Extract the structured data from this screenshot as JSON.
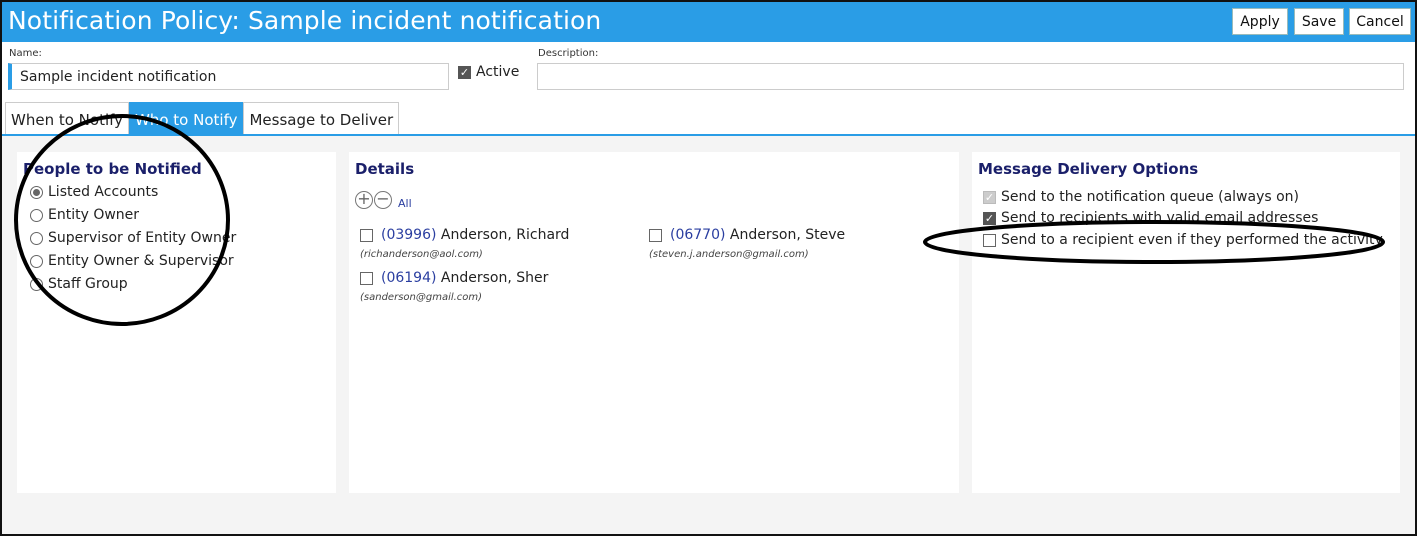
{
  "header": {
    "title": "Notification Policy: Sample incident notification",
    "apply_label": "Apply",
    "save_label": "Save",
    "cancel_label": "Cancel"
  },
  "form": {
    "name_label": "Name:",
    "name_value": "Sample incident notification",
    "active_label": "Active",
    "active_checked": true,
    "description_label": "Description:",
    "description_value": ""
  },
  "tabs": [
    {
      "label": "When to Notify"
    },
    {
      "label": "Who to Notify",
      "active": true
    },
    {
      "label": "Message to Deliver"
    }
  ],
  "people_panel": {
    "title": "People to be Notified",
    "options": [
      {
        "label": "Listed Accounts",
        "selected": true
      },
      {
        "label": "Entity Owner"
      },
      {
        "label": "Supervisor of Entity Owner"
      },
      {
        "label": "Entity Owner & Supervisor"
      },
      {
        "label": "Staff Group"
      }
    ]
  },
  "details_panel": {
    "title": "Details",
    "plus_glyph": "+",
    "minus_glyph": "−",
    "all_label": "All",
    "people": [
      {
        "id": "(03996)",
        "name": "Anderson, Richard",
        "email": "(richanderson@aol.com)"
      },
      {
        "id": "(06194)",
        "name": "Anderson, Sher",
        "email": "(sanderson@gmail.com)"
      },
      {
        "id": "(06770)",
        "name": "Anderson, Steve",
        "email": "(steven.j.anderson@gmail.com)"
      }
    ]
  },
  "delivery_panel": {
    "title": "Message Delivery Options",
    "options": [
      {
        "label": "Send to the notification queue (always on)",
        "checked": true,
        "disabled": true
      },
      {
        "label": "Send to recipients with valid email addresses",
        "checked": true
      },
      {
        "label": "Send to a recipient even if they performed the activity",
        "checked": false
      }
    ]
  },
  "colors": {
    "accent": "#2a9de6",
    "panel_title": "#1a1f6a",
    "link": "#2a3ea0",
    "annotation": "#000000"
  }
}
